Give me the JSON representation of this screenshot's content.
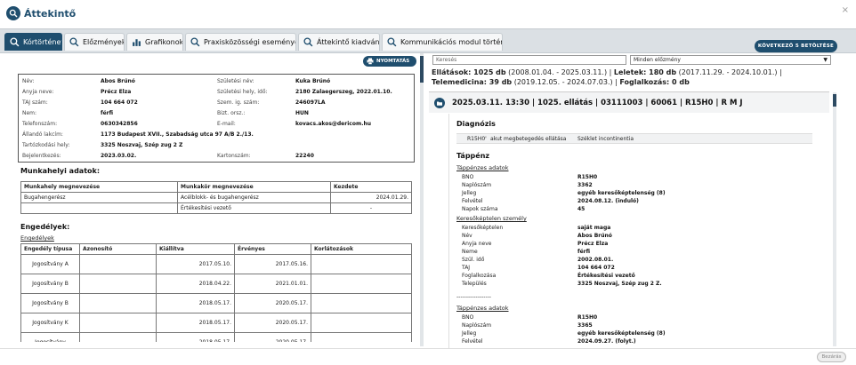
{
  "window": {
    "title": "Áttekintő",
    "close": "×"
  },
  "tabs": [
    {
      "label": "Kórtörténet"
    },
    {
      "label": "Előzmények"
    },
    {
      "label": "Grafikonok"
    },
    {
      "label": "Praxisközösségi események"
    },
    {
      "label": "Áttekintő kiadvány"
    },
    {
      "label": "Kommunikációs modul történet"
    }
  ],
  "next_button": "KÖVETKEZŐ 5 BETÖLTÉSE",
  "print_button": "NYOMTATÁS",
  "patient": {
    "nev_l": "Név:",
    "nev": "Abos Brúnó",
    "szul_nev_l": "Születési név:",
    "szul_nev": "Kuka Brúnó",
    "anyja_l": "Anyja neve:",
    "anyja": "Précz Elza",
    "szul_hely_l": "Születési hely, idő:",
    "szul_hely": "2180 Zalaegerszeg, 2022.01.10.",
    "taj_l": "TAJ szám:",
    "taj": "104 664 072",
    "szig_l": "Szem. ig. szám:",
    "szig": "246097LA",
    "nem_l": "Nem:",
    "nem": "férfi",
    "allampolg_l": "Bizt. orsz.:",
    "allampolg": "HUN",
    "tel_l": "Telefonszám:",
    "tel": "0630342856",
    "email_l": "E-mail:",
    "email": "kovacs.akos@dericom.hu",
    "lakcim_l": "Állandó lakcím:",
    "lakcim": "1173 Budapest XVII., Szabadság utca 97 A/B 2./13.",
    "tart_l": "Tartózkodási hely:",
    "tart": "3325 Noszvaj, Szép zug 2 Z",
    "bejel_l": "Bejelentkezés:",
    "bejel": "2023.03.02.",
    "karton_l": "Kartonszám:",
    "karton": "22240"
  },
  "work": {
    "title": "Munkahelyi adatok:",
    "headers": [
      "Munkahely megnevezése",
      "Munkakör megnevezése",
      "Kezdete"
    ],
    "rows": [
      [
        "Bugahengerész",
        "Acélblokk- és bugahengerész",
        "2024.01.29."
      ],
      [
        "",
        "Értékesítési vezető",
        "-"
      ]
    ]
  },
  "permits": {
    "title": "Engedélyek:",
    "link": "Engedélyek",
    "headers": [
      "Engedély típusa",
      "Azonosító",
      "Kiállítva",
      "Érvényes",
      "Korlátozások"
    ],
    "rows": [
      [
        "Jogosítvány A",
        "",
        "2017.05.10.",
        "2017.05.16.",
        ""
      ],
      [
        "Jogosítvány B",
        "",
        "2018.04.22.",
        "2021.01.01.",
        ""
      ],
      [
        "Jogosítvány B",
        "",
        "2018.05.17.",
        "2020.05.17.",
        ""
      ],
      [
        "Jogosítvány K",
        "",
        "2018.05.17.",
        "2020.05.17.",
        ""
      ],
      [
        "Jogosítvány",
        "",
        "2018.05.17.",
        "2020.05.17.",
        ""
      ]
    ]
  },
  "right": {
    "search_placeholder": "Keresés",
    "filter_value": "Minden előzmény",
    "summary": {
      "ellatasok_l": "Ellátások: 1025 db",
      "ellatasok_r": " (2008.01.04. - 2025.03.11.) | ",
      "leletek_l": "Leletek: 180 db",
      "leletek_r": " (2017.11.29. - 2024.10.01.) | ",
      "tele_l": "Telemedicina: 39 db",
      "tele_r": " (2019.12.05. - 2024.07.03.) | ",
      "fogl_l": "Foglalkozás: 0 db"
    },
    "event_title": "2025.03.11. 13:30 | 1025. ellátás | 03111003 | 60061 | R15H0 | R M J",
    "diagnozis_title": "Diagnózis",
    "diag_code": "R15H0'",
    "diag_type": "akut megbetegedés ellátása",
    "diag_name": "Széklet incontinentia",
    "tappenz_title": "Táppénz",
    "tappenz_adatok": "Táppénzes adatok",
    "t1": [
      [
        "BNO",
        "R15H0"
      ],
      [
        "Naplószám",
        "3362"
      ],
      [
        "Jelleg",
        "egyéb keresőképtelenség (8)"
      ],
      [
        "Felvétel",
        "2024.08.12. (induló)"
      ],
      [
        "Napok száma",
        "45"
      ]
    ],
    "kereso_title": "Keresőképtelen személy",
    "k1": [
      [
        "Keresőképtelen",
        "saját maga"
      ],
      [
        "Név",
        "Abos Brúnó"
      ],
      [
        "Anyja neve",
        "Précz Elza"
      ],
      [
        "Neme",
        "férfi"
      ],
      [
        "Szül. idő",
        "2002.08.01."
      ],
      [
        "TAJ",
        "104 664 072"
      ],
      [
        "Foglalkozása",
        "Értékesítési vezető"
      ],
      [
        "Település",
        "3325 Noszvaj, Szép zug 2 Z."
      ]
    ],
    "divider": "------------------",
    "tappenz_adatok2": "Táppénzes adatok",
    "t2": [
      [
        "BNO",
        "R15H0"
      ],
      [
        "Naplószám",
        "3365"
      ],
      [
        "Jelleg",
        "egyéb keresőképtelenség (8)"
      ],
      [
        "Felvétel",
        "2024.09.27. (folyt.)"
      ]
    ]
  },
  "footer": {
    "close_button": "Bezárás"
  },
  "colors": {
    "primary": "#1f4e6e"
  }
}
